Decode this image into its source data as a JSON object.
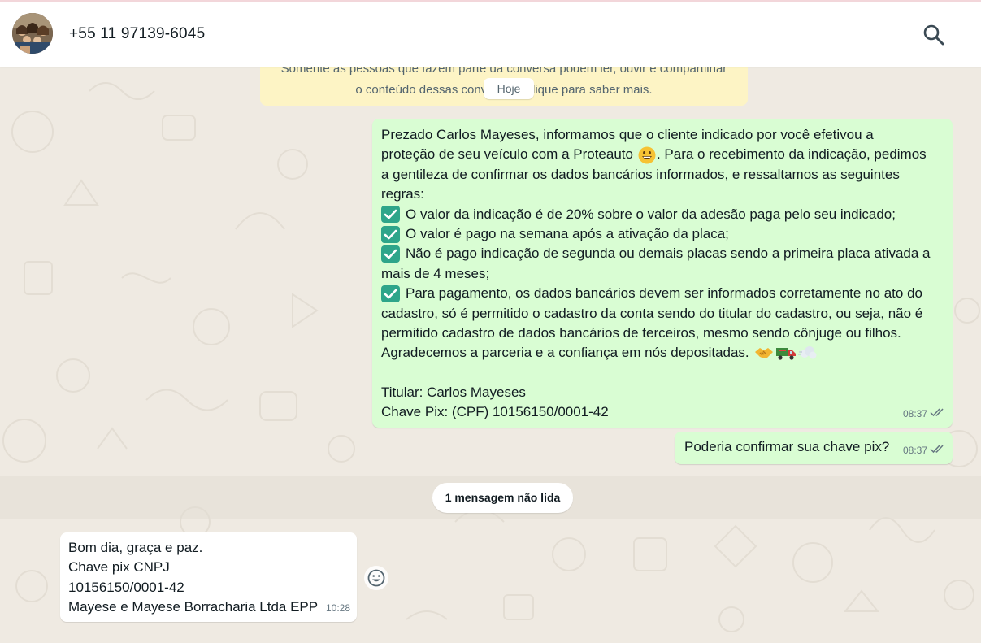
{
  "header": {
    "contact_name": "+55 11 97139-6045",
    "avatar_icon": "group-photo-avatar",
    "search_icon": "search-icon"
  },
  "chat": {
    "encryption_notice": {
      "line1": "Somente as pessoas que fazem parte da conversa podem ler, ouvir e compartilhar",
      "line2": "o conteúdo dessas conversas. Clique para saber mais."
    },
    "date_chip": "Hoje",
    "unread_label": "1 mensagem não lida",
    "messages": [
      {
        "direction": "outgoing",
        "lines": [
          "Prezado Carlos Mayeses, informamos que o cliente indicado por você efetivou a",
          "proteção de seu veículo com a Proteauto",
          ". Para o recebimento da indicação, pedimos",
          "a gentileza de confirmar os dados bancários informados, e  ressaltamos as seguintes",
          "regras:",
          "O valor da indicação é de 20% sobre o valor da adesão paga pelo seu indicado;",
          "O valor é pago na semana após a ativação da placa;",
          "Não é pago indicação de segunda ou demais placas sendo a primeira placa ativada a",
          "mais de 4 meses;",
          "Para pagamento, os dados bancários devem ser informados corretamente no ato do",
          "cadastro, só é permitido o cadastro da conta sendo do titular do cadastro, ou seja, não é",
          "permitido cadastro de dados bancários de terceiros, mesmo sendo cônjuge ou filhos.",
          "Agradecemos a parceria e a confiança em nós depositadas.",
          "Titular: Carlos Mayeses",
          "Chave Pix: (CPF) 10156150/0001-42"
        ],
        "time": "08:37",
        "status": "read"
      },
      {
        "direction": "outgoing",
        "text": "Poderia confirmar sua chave pix?",
        "time": "08:37",
        "status": "read"
      },
      {
        "direction": "incoming",
        "lines": [
          "Bom dia, graça e paz.",
          "Chave pix CNPJ",
          "10156150/0001-42",
          "Mayese e Mayese Borracharia Ltda EPP"
        ],
        "time": "10:28"
      }
    ]
  },
  "colors": {
    "outgoing_bubble": "#d9fdd3",
    "incoming_bubble": "#ffffff",
    "chat_background": "#efeae2",
    "notice_background": "#fdf4c5",
    "check_emoji": "#2ea58a"
  }
}
